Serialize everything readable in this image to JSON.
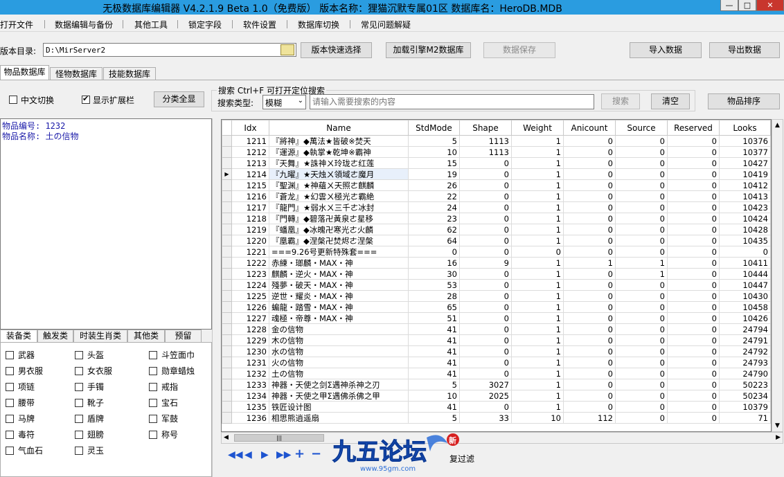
{
  "window": {
    "title": "无极数据库编辑器 V4.2.1.9    Beta 1.0（免费版）    版本名称：狸猫沉默专属01区    数据库名：HeroDB.MDB",
    "minimize": "—",
    "maximize": "□",
    "close": "✕"
  },
  "menu": [
    "打开文件",
    "数据编辑与备份",
    "其他工具",
    "锁定字段",
    "软件设置",
    "数据库切换",
    "常见问题解疑"
  ],
  "toolbar": {
    "dir_label": "版本目录:",
    "dir_value": "D:\\MirServer2",
    "quick_select": "版本快速选择",
    "load_m2": "加载引擎M2数据库",
    "save": "数据保存",
    "import": "导入数据",
    "export": "导出数据"
  },
  "tabs": [
    "物品数据库",
    "怪物数据库",
    "技能数据库"
  ],
  "options": {
    "chinese_toggle": "中文切换",
    "show_expand": "显示扩展栏",
    "show_all_categories": "分类全显"
  },
  "search": {
    "hint": "搜索   Ctrl+F  可打开定位搜索",
    "type_label": "搜索类型:",
    "type_value": "模糊",
    "placeholder": "请输入需要搜索的内容",
    "search_button": "搜索",
    "clear_button": "清空",
    "sort_button": "物品排序"
  },
  "info": {
    "item_id": "物品编号: 1232",
    "item_name": "物品名称: 土の信物"
  },
  "category_tabs": [
    "装备类",
    "触发类",
    "时装生肖类",
    "其他类",
    "预留"
  ],
  "category_items": [
    [
      "武器",
      "头盔",
      "斗笠面巾"
    ],
    [
      "男衣服",
      "女衣服",
      "勋章蜡烛"
    ],
    [
      "项链",
      "手镯",
      "戒指"
    ],
    [
      "腰带",
      "靴子",
      "宝石"
    ],
    [
      "马牌",
      "盾牌",
      "军鼓"
    ],
    [
      "毒符",
      "翅膀",
      "称号"
    ],
    [
      "气血石",
      "灵玉",
      ""
    ]
  ],
  "grid": {
    "columns": [
      "Idx",
      "Name",
      "StdMode",
      "Shape",
      "Weight",
      "Anicount",
      "Source",
      "Reserved",
      "Looks"
    ],
    "selected_idx": "1214",
    "rows": [
      [
        "1211",
        "『將神』◆萬法★皆破※焚天",
        "5",
        "1113",
        "1",
        "0",
        "0",
        "0",
        "10376"
      ],
      [
        "1212",
        "『運源』◆執掌★乾坤※霸神",
        "10",
        "1113",
        "1",
        "0",
        "0",
        "0",
        "10377"
      ],
      [
        "1213",
        "『天舞』★誅神ㄨ玲珑ㄜ红莲",
        "15",
        "0",
        "1",
        "0",
        "0",
        "0",
        "10427"
      ],
      [
        "1214",
        "『九曜』★天烛ㄨ領域ㄜ魔月",
        "19",
        "0",
        "1",
        "0",
        "0",
        "0",
        "10419"
      ],
      [
        "1215",
        "『聖渊』★神蘊ㄨ天照ㄜ麒麟",
        "26",
        "0",
        "1",
        "0",
        "0",
        "0",
        "10412"
      ],
      [
        "1216",
        "『蒼龙』★幻雲ㄨ極光ㄜ霸絶",
        "22",
        "0",
        "1",
        "0",
        "0",
        "0",
        "10413"
      ],
      [
        "1217",
        "『龍門』★弱水ㄨ三千ㄜ冰封",
        "24",
        "0",
        "1",
        "0",
        "0",
        "0",
        "10423"
      ],
      [
        "1218",
        "『門轉』◆碧落卍黃泉ㄜ星移",
        "23",
        "0",
        "1",
        "0",
        "0",
        "0",
        "10424"
      ],
      [
        "1219",
        "『蟠凰』◆冰魄卍寒光ㄜ火麟",
        "62",
        "0",
        "1",
        "0",
        "0",
        "0",
        "10428"
      ],
      [
        "1220",
        "『凰霸』◆涅槃卍焚烬ㄜ涅槃",
        "64",
        "0",
        "1",
        "0",
        "0",
        "0",
        "10435"
      ],
      [
        "1221",
        "===9.26号更新特殊套===",
        "0",
        "0",
        "0",
        "0",
        "0",
        "0",
        "0"
      ],
      [
        "1222",
        "赤練・瑯麟・MAX・神",
        "16",
        "9",
        "1",
        "1",
        "1",
        "0",
        "10411"
      ],
      [
        "1223",
        "麒麟・逆火・MAX・神",
        "30",
        "0",
        "1",
        "0",
        "1",
        "0",
        "10444"
      ],
      [
        "1224",
        "殘夢・破天・MAX・神",
        "53",
        "0",
        "1",
        "0",
        "0",
        "0",
        "10447"
      ],
      [
        "1225",
        "逆世・耀炎・MAX・神",
        "28",
        "0",
        "1",
        "0",
        "0",
        "0",
        "10430"
      ],
      [
        "1226",
        "蝙龍・踏雪・MAX・神",
        "65",
        "0",
        "1",
        "0",
        "0",
        "0",
        "10458"
      ],
      [
        "1227",
        "魂極・帝尊・MAX・神",
        "51",
        "0",
        "1",
        "0",
        "0",
        "0",
        "10426"
      ],
      [
        "1228",
        "金の信物",
        "41",
        "0",
        "1",
        "0",
        "0",
        "0",
        "24794"
      ],
      [
        "1229",
        "木の信物",
        "41",
        "0",
        "1",
        "0",
        "0",
        "0",
        "24791"
      ],
      [
        "1230",
        "水の信物",
        "41",
        "0",
        "1",
        "0",
        "0",
        "0",
        "24792"
      ],
      [
        "1231",
        "火の信物",
        "41",
        "0",
        "1",
        "0",
        "0",
        "0",
        "24793"
      ],
      [
        "1232",
        "土の信物",
        "41",
        "0",
        "1",
        "0",
        "0",
        "0",
        "24790"
      ],
      [
        "1233",
        "神器・天使之剑Σ遇神杀神之刃",
        "5",
        "3027",
        "1",
        "0",
        "0",
        "0",
        "50223"
      ],
      [
        "1234",
        "神器・天使之甲Σ遇佛杀佛之甲",
        "10",
        "2025",
        "1",
        "0",
        "0",
        "0",
        "50234"
      ],
      [
        "1235",
        "铁匠设计图",
        "41",
        "0",
        "1",
        "0",
        "0",
        "0",
        "10379"
      ],
      [
        "1236",
        "相思熊逍遥扇",
        "5",
        "33",
        "10",
        "112",
        "0",
        "0",
        "71"
      ]
    ]
  },
  "navigator": {
    "first": "◀◀",
    "prev": "◀",
    "next": "▶",
    "last": "▶▶",
    "add": "+",
    "delete": "−",
    "filter_label": "复过滤"
  },
  "watermark": {
    "logo": "九五论坛",
    "badge": "新",
    "url": "www.95gm.com"
  },
  "colors": {
    "titlebar": "#2a9ce0",
    "info_text": "#1a1aa8",
    "nav_blue": "#1e54d0"
  }
}
